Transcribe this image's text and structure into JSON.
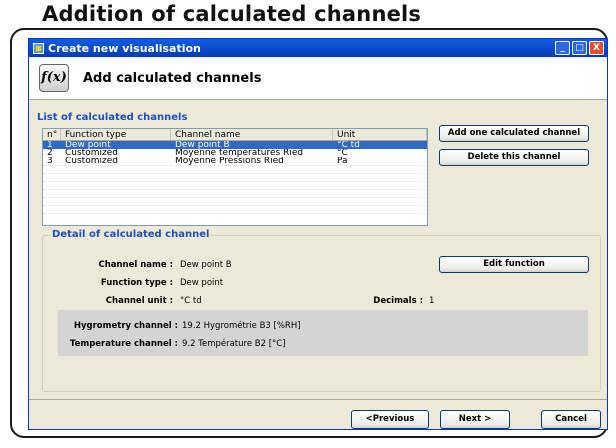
{
  "banner_title": "Addition of calculated channels",
  "window": {
    "title": "Create new visualisation",
    "controls": [
      "_",
      "□",
      "X"
    ]
  },
  "header": {
    "icon_text": "f(x)",
    "title": "Add calculated channels"
  },
  "list": {
    "label": "List of calculated channels",
    "columns": [
      "n°",
      "Function type",
      "Channel name",
      "Unit"
    ],
    "rows": [
      {
        "n": "1",
        "function_type": "Dew point",
        "channel_name": "Dew point B",
        "unit": "°C td",
        "selected": true
      },
      {
        "n": "2",
        "function_type": "Customized",
        "channel_name": "Moyenne températures Ried",
        "unit": "°C",
        "selected": false
      },
      {
        "n": "3",
        "function_type": "Customized",
        "channel_name": "Moyenne Pressions Ried",
        "unit": "Pa",
        "selected": false
      }
    ]
  },
  "buttons": {
    "add": "Add one calculated channel",
    "delete": "Delete this channel",
    "edit": "Edit function",
    "previous": "<Previous",
    "next": "Next >",
    "cancel": "Cancel"
  },
  "detail": {
    "legend": "Detail of calculated channel",
    "channel_name_label": "Channel name :",
    "channel_name": "Dew point B",
    "function_type_label": "Function type :",
    "function_type": "Dew point",
    "channel_unit_label": "Channel unit :",
    "channel_unit": "°C td",
    "decimals_label": "Decimals :",
    "decimals": "1",
    "hygrometry_label": "Hygrometry channel :",
    "hygrometry": "19.2 Hygrométrie B3 [%RH]",
    "temperature_label": "Temperature channel :",
    "temperature": "9.2 Température B2 [°C]"
  },
  "colors": {
    "accent": "#1f4fc0",
    "selection": "#316ac5",
    "titlebar": "#0b48c8"
  }
}
